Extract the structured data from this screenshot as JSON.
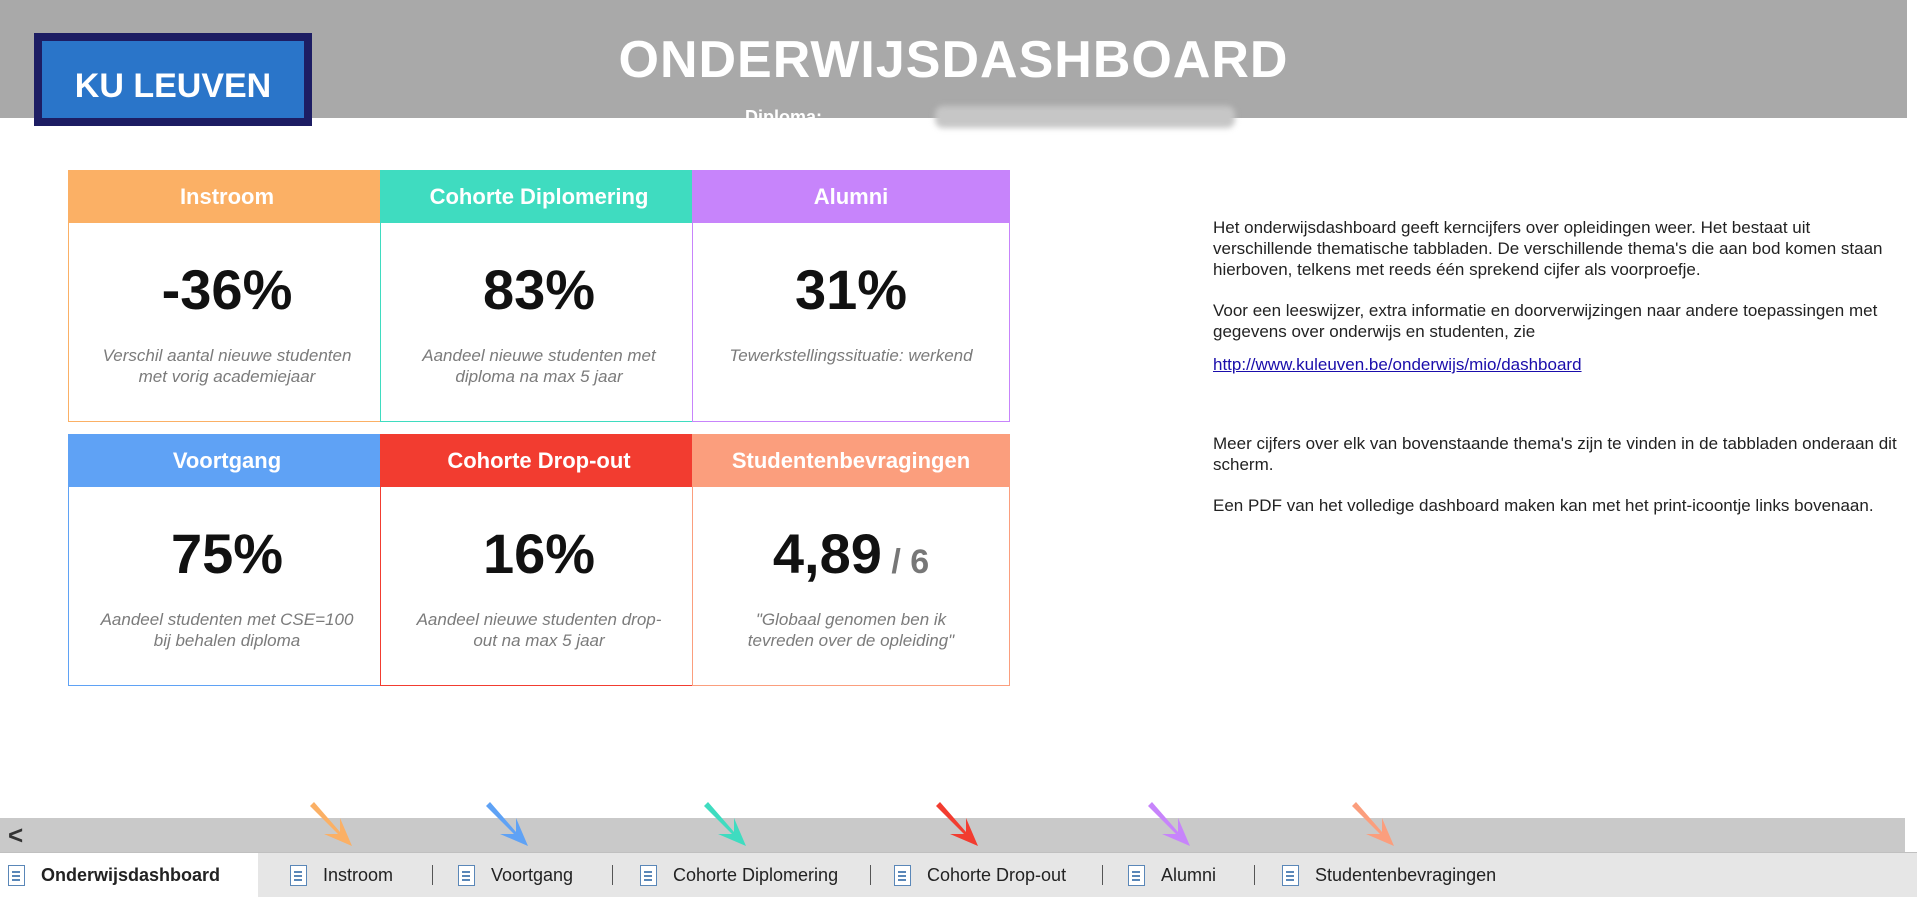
{
  "header": {
    "logo_text": "KU LEUVEN",
    "title": "ONDERWIJSDASHBOARD",
    "subtitle_label": "Diploma:"
  },
  "cards": [
    {
      "title": "Instroom",
      "value": "-36%",
      "suffix": "",
      "desc": "Verschil aantal nieuwe studenten met vorig academiejaar",
      "color": "#fbb065"
    },
    {
      "title": "Cohorte Diplomering",
      "value": "83%",
      "suffix": "",
      "desc": "Aandeel nieuwe studenten met diploma na max 5 jaar",
      "color": "#3fdcc0"
    },
    {
      "title": "Alumni",
      "value": "31%",
      "suffix": "",
      "desc": "Tewerkstellingssituatie: werkend",
      "color": "#c784fb"
    },
    {
      "title": "Voortgang",
      "value": "75%",
      "suffix": "",
      "desc": "Aandeel studenten met CSE=100 bij behalen diploma",
      "color": "#5fa2f5"
    },
    {
      "title": "Cohorte Drop-out",
      "value": "16%",
      "suffix": "",
      "desc": "Aandeel nieuwe studenten drop-out na max 5 jaar",
      "color": "#f23c30"
    },
    {
      "title": "Studentenbevragingen",
      "value": "4,89",
      "suffix": " / 6",
      "desc": "\"Globaal genomen ben ik tevreden over de opleiding\"",
      "color": "#fb9e7d"
    }
  ],
  "info": {
    "para1": "Het onderwijsdashboard geeft kerncijfers over opleidingen weer. Het bestaat uit verschillende thematische tabbladen.  De verschillende thema's die aan bod komen staan hierboven, telkens met reeds één sprekend cijfer als voorproefje.",
    "para2": "Voor een leeswijzer, extra informatie en doorverwijzingen naar andere toepassingen met gegevens over onderwijs en studenten, zie",
    "link": "http://www.kuleuven.be/onderwijs/mio/dashboard",
    "para3": "Meer cijfers over elk van bovenstaande thema's zijn te vinden in de tabbladen onderaan dit scherm.",
    "para4": "Een PDF van het volledige dashboard maken kan met het print-icoontje links bovenaan."
  },
  "scroll": {
    "left_glyph": "<"
  },
  "arrows": [
    "#fbb065",
    "#5fa2f5",
    "#3fdcc0",
    "#f23c30",
    "#c784fb",
    "#fb9e7d"
  ],
  "tabs": [
    {
      "label": "Onderwijsdashboard",
      "active": true
    },
    {
      "label": "Instroom",
      "active": false
    },
    {
      "label": "Voortgang",
      "active": false
    },
    {
      "label": "Cohorte Diplomering",
      "active": false
    },
    {
      "label": "Cohorte Drop-out",
      "active": false
    },
    {
      "label": "Alumni",
      "active": false
    },
    {
      "label": "Studentenbevragingen",
      "active": false
    }
  ]
}
